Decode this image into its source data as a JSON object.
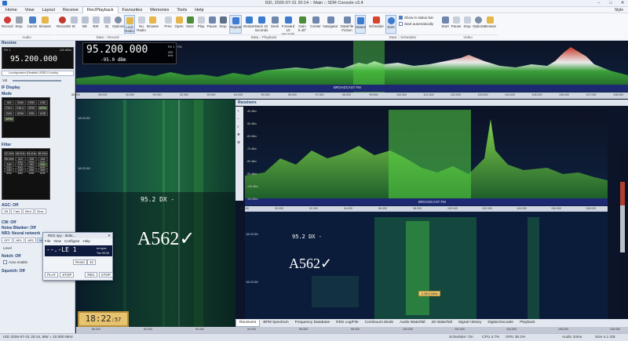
{
  "window": {
    "title": "ISD, 2026-07-31 20:14 :: Main :: SDR Console v3.4",
    "style": "Style"
  },
  "menu": [
    "Home",
    "View",
    "Layout",
    "Receive",
    "Rec/Playback",
    "Favourites",
    "Memories",
    "Tools",
    "Help"
  ],
  "menu_active_index": 4,
  "ribbon": {
    "audio": {
      "group": "Audio",
      "buttons": [
        "Record",
        "Stop",
        "Cache",
        "Browse"
      ]
    },
    "data_record": {
      "group": "Data :: Record",
      "buttons": [
        "Recorder",
        "IE",
        "BE",
        "BIE",
        "IQ",
        "Options",
        "Lock Radio",
        "No Radio",
        "Browse"
      ]
    },
    "data_playback": {
      "group": "Data :: Playback",
      "buttons": [
        "Prev",
        "Open",
        "Next",
        "Play",
        "Pause",
        "Stop",
        "Repeat",
        "Restart",
        "Back 10 seconds",
        "Seek",
        "Forward 10 seconds",
        "Gain 0.49°",
        "Center",
        "Navigator",
        "DataFile Fiction",
        "Status"
      ]
    },
    "data_scheduler": {
      "group": "Data :: Scheduler",
      "buttons": [
        "Schedule",
        "Start"
      ],
      "checks": [
        "Show in status bar",
        "Start automatically"
      ]
    },
    "video": {
      "group": "Video",
      "buttons": [
        "Start",
        "Pause",
        "Stop",
        "Options",
        "Browse"
      ]
    }
  },
  "left": {
    "header": "Receive",
    "rx_label": "RX 1",
    "rx_signal": "-110 dBm",
    "frequency": "95.200.000",
    "audio_device": "Loudspeaker (Realtek  USB2.0 Audio)",
    "vol_label": "Vol",
    "if_display": "IF Display",
    "mode_label": "Mode",
    "modes": [
      "AM",
      "SAM",
      "DSB",
      "LSB",
      "CW-L",
      "CW-U",
      "NFM",
      "WFM",
      "DIGI",
      "DRM",
      "SSB",
      "USB",
      "WFM"
    ],
    "mode_selected": "WFM",
    "filter_label": "Filter",
    "filters": [
      "32 kHz",
      "48 kHz",
      "64 kHz",
      "80 kHz",
      "96 kHz",
      "112 kHz",
      "128 kHz",
      "144 kHz",
      "160 kHz",
      "176 kHz",
      "192 kHz",
      "200 kHz",
      "220 kHz",
      "240 kHz",
      "256 kHz",
      "300 kHz"
    ],
    "filter_selected": "200 kHz",
    "agc": "AGC: Off",
    "agc_options": [
      "Off",
      "Fast",
      "Med",
      "Slow"
    ],
    "cw": "CW: Off",
    "noise_blanker": "Noise Blanker: Off",
    "nr3": "NR3: Neural network",
    "nr_options": [
      "OFF",
      "NR1",
      "NR2",
      "NR3"
    ],
    "level": "Level",
    "notch": "Notch: Off",
    "auto_enable": "Auto enable",
    "squelch": "Squelch: Off"
  },
  "top_display": {
    "frequency": "95.200.000",
    "rx": "RX 1",
    "mode": "FM",
    "bandwidth": "200 kHz",
    "level": "-95.0 dBm",
    "band": "BROADCAST FM"
  },
  "wf_left": {
    "times": [
      "18:22:55",
      "18:22:58"
    ],
    "rds": "95.2 DX -"
  },
  "clock": {
    "hhmm": "18:22",
    "ss": ":57"
  },
  "handwriting": "A562✓",
  "popup": {
    "title": "RDS spy - delta...",
    "menu": [
      "File",
      "View",
      "Configure",
      "Help"
    ],
    "freq": "--.-LE 1",
    "mode": "no sync",
    "time": "Tue 00:34",
    "buttons": [
      "PLAY",
      "STOP",
      "REC",
      "STOP"
    ],
    "reset": "Reset",
    "val": "32"
  },
  "receivers": {
    "title": "Receivers",
    "band": "BROADCAST FM",
    "rds": "95.2 DX -",
    "marker": "1 95.2 MHz",
    "times": [
      "18:22:55",
      "18:22:58"
    ],
    "db_ticks": [
      "-45 dBm",
      "-55 dBm",
      "-65 dBm",
      "-75 dBm",
      "-85 dBm",
      "-95 dBm",
      "-105 dBm",
      "-115 dBm"
    ]
  },
  "tabs": [
    "Receivers",
    "BPM Spectrum",
    "Frequency Database",
    "RDS Log/File",
    "Continuum Mode",
    "Audio Waterfall",
    "2D Waterfall",
    "Signal History",
    "Digital Decoder",
    "Playback"
  ],
  "scale_top": [
    "88.000",
    "89.000",
    "90.000",
    "91.000",
    "92.000",
    "93.000",
    "94.000",
    "95.000",
    "96.000",
    "97.000",
    "98.000",
    "99.000",
    "100.000",
    "101.000",
    "102.000",
    "103.000",
    "104.000",
    "105.000",
    "106.000",
    "107.000",
    "108.000"
  ],
  "scale_bottom": [
    "88.000",
    "90.000",
    "92.000",
    "94.000",
    "96.000",
    "98.000",
    "100.000",
    "102.000",
    "104.000",
    "106.000",
    "108.000"
  ],
  "status": {
    "left": "ISD 2026-07-31 20:14, BW = 10.000 MHz",
    "scheduler": "Scheduler: On",
    "cpu": "CPU 4.7%",
    "gpu": "GPU 36.2%",
    "audio": "Audio 10ms",
    "size": "Size 4.1 GB"
  }
}
